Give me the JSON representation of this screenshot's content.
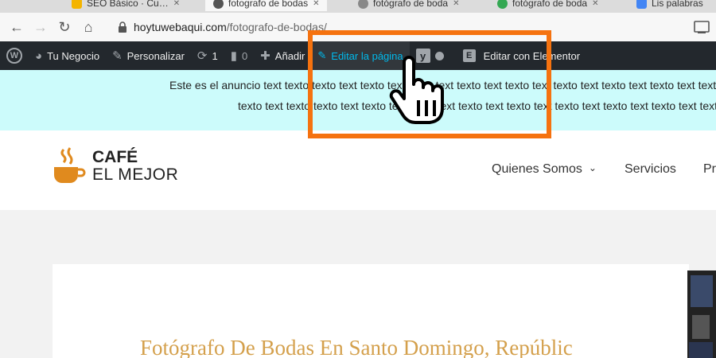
{
  "browser": {
    "tabs": [
      {
        "label": "SEO Básico · Cu…",
        "color": "#f4b400"
      },
      {
        "label": "fotografo de bodas",
        "color": "#555555"
      },
      {
        "label": "fotógrafo de boda",
        "color": "#34a853"
      },
      {
        "label": "Lis palabras",
        "color": "#4285f4"
      }
    ],
    "url_host": "hoytuwebaqui.com",
    "url_path": "/fotografo-de-bodas/"
  },
  "adminbar": {
    "site_name": "Tu Negocio",
    "customize": "Personalizar",
    "updates_count": "1",
    "comments_count": "0",
    "new_label": "Añadir",
    "edit_page": "Editar la página",
    "elementor": "Editar con Elementor"
  },
  "announcement": {
    "line1": "Este es el anuncio text texto texto text texto text texto text texto text texto text texto text texto text texto text texto",
    "line2": "texto text texto texto text texto text texto text texto text texto text texto text texto text texto text texto text texto"
  },
  "header": {
    "logo_line1": "CAFÉ",
    "logo_line2": "EL MEJOR",
    "nav": [
      "Quienes Somos",
      "Servicios",
      "Pr"
    ]
  },
  "page": {
    "title": "Fotógrafo De Bodas En Santo Domingo, Repúblic"
  },
  "colors": {
    "adminbar_bg": "#23282d",
    "announce_bg": "#ccfbfb",
    "title_gold": "#d4a04c",
    "highlight_orange": "#f5720f",
    "edit_link": "#00b9eb"
  }
}
